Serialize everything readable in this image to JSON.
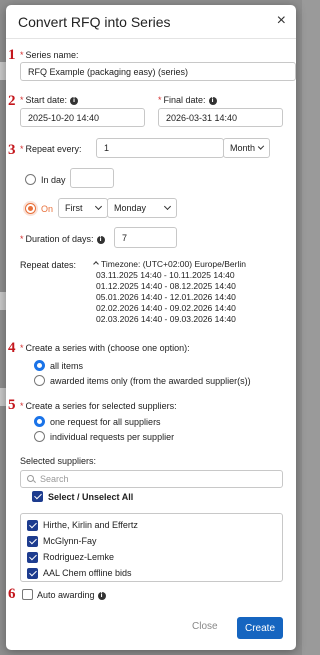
{
  "dialog": {
    "title": "Convert RFQ into Series",
    "close_glyph": "×"
  },
  "steps": [
    "1",
    "2",
    "3",
    "4",
    "5",
    "6"
  ],
  "series_name": {
    "label": "Series name:",
    "value": "RFQ Example (packaging easy) (series)"
  },
  "start_date": {
    "label": "Start date:",
    "value": "2025-10-20 14:40"
  },
  "final_date": {
    "label": "Final date:",
    "value": "2026-03-31 14:40"
  },
  "repeat": {
    "label": "Repeat every:",
    "value": "1",
    "unit": "Month",
    "option_in_day": "In day",
    "in_day_value": "",
    "option_on": "On",
    "on_ordinal": "First",
    "on_weekday": "Monday",
    "selected_option": "On"
  },
  "duration": {
    "label": "Duration of days:",
    "value": "7"
  },
  "repeat_dates": {
    "label": "Repeat dates:",
    "timezone": "Timezone: (UTC+02:00) Europe/Berlin",
    "ranges": [
      "03.11.2025 14:40 - 10.11.2025 14:40",
      "01.12.2025 14:40 - 08.12.2025 14:40",
      "05.01.2026 14:40 - 12.01.2026 14:40",
      "02.02.2026 14:40 - 09.02.2026 14:40",
      "02.03.2026 14:40 - 09.03.2026 14:40"
    ]
  },
  "create_with": {
    "label": "Create a series with (choose one option):",
    "options": [
      "all items",
      "awarded items only (from the awarded supplier(s))"
    ],
    "selected": "all items"
  },
  "create_for": {
    "label": "Create a series for selected suppliers:",
    "options": [
      "one request for all suppliers",
      "individual requests per supplier"
    ],
    "selected": "one request for all suppliers"
  },
  "suppliers": {
    "label": "Selected suppliers:",
    "search_placeholder": "Search",
    "select_all_label": "Select / Unselect All",
    "items": [
      {
        "name": "Hirthe, Kirlin and Effertz",
        "checked": true
      },
      {
        "name": "McGlynn-Fay",
        "checked": true
      },
      {
        "name": "Rodriguez-Lemke",
        "checked": true
      },
      {
        "name": "AAL Chem offline bids",
        "checked": true
      }
    ]
  },
  "auto_awarding": {
    "label": "Auto awarding",
    "checked": false
  },
  "footer": {
    "close_label": "Close",
    "create_label": "Create"
  },
  "colors": {
    "step_number": "#c4161c",
    "required_star": "#d32f2f",
    "primary_button": "#1565c0",
    "radio_selected": "#1a73e8",
    "radio_on_accent": "#e8703a",
    "checkbox": "#1d3c8f"
  },
  "icons": {
    "info": "info-circle-icon",
    "close": "close-icon",
    "search": "search-icon",
    "dropdown": "chevron-down-icon",
    "collapse": "chevron-up-icon"
  }
}
